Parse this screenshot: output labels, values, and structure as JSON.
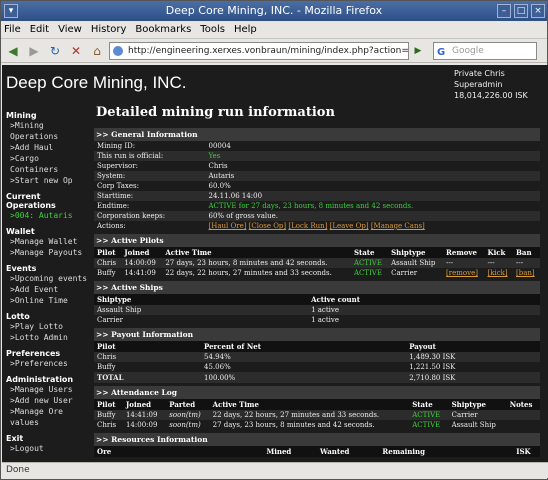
{
  "window": {
    "title": "Deep Core Mining, INC. - Mozilla Firefox"
  },
  "menu": [
    "File",
    "Edit",
    "View",
    "History",
    "Bookmarks",
    "Tools",
    "Help"
  ],
  "nav": {
    "url": "http://engineering.xerxes.vonbraun/mining/index.php?action=show&id=4",
    "search_placeholder": "Google"
  },
  "header": {
    "brand": "Deep Core Mining, INC.",
    "user_line1": "Private  Chris",
    "user_line2": "Superadmin",
    "user_line3": "18,014,226.00  ISK"
  },
  "sidebar": [
    {
      "section": "Mining",
      "items": [
        ">Mining Operations",
        ">Add Haul",
        ">Cargo Containers",
        ">Start new Op"
      ]
    },
    {
      "section": "Current Operations",
      "items": [
        ">004: Autaris"
      ],
      "active": 0
    },
    {
      "section": "Wallet",
      "items": [
        ">Manage Wallet",
        ">Manage Payouts"
      ]
    },
    {
      "section": "Events",
      "items": [
        ">Upcoming events",
        ">Add Event",
        ">Online Time"
      ]
    },
    {
      "section": "Lotto",
      "items": [
        ">Play Lotto",
        ">Lotto Admin"
      ]
    },
    {
      "section": "Preferences",
      "items": [
        ">Preferences"
      ]
    },
    {
      "section": "Administration",
      "items": [
        ">Manage Users",
        ">Add new User",
        ">Manage Ore values"
      ]
    },
    {
      "section": "Exit",
      "items": [
        ">Logout"
      ]
    }
  ],
  "main": {
    "title": "Detailed mining run information",
    "general": {
      "heading": ">> General Information",
      "rows": [
        [
          "Mining ID:",
          "00004"
        ],
        [
          "This run is official:",
          "Yes"
        ],
        [
          "Supervisor:",
          "Chris"
        ],
        [
          "System:",
          "Autaris"
        ],
        [
          "Corp Taxes:",
          "60.0%"
        ],
        [
          "Starttime:",
          "24.11.06 14:00"
        ],
        [
          "Endtime:",
          "ACTIVE for 27 days, 23 hours, 8 minutes and 42 seconds."
        ],
        [
          "Corporation keeps:",
          "60% of gross value."
        ]
      ],
      "actions_label": "Actions:",
      "actions": [
        "[Haul Ore]",
        "[Close Op]",
        "[Lock Run]",
        "[Leave Op]",
        "[Manage Cans]"
      ]
    },
    "pilots": {
      "heading": ">> Active Pilots",
      "columns": [
        "Pilot",
        "Joined",
        "Active Time",
        "State",
        "Shiptype",
        "Remove",
        "Kick",
        "Ban"
      ],
      "rows": [
        [
          "Chris",
          "14:00:09",
          "27 days, 23 hours, 8 minutes and 42 seconds.",
          "ACTIVE",
          "Assault Ship",
          "---",
          "---",
          "---"
        ],
        [
          "Buffy",
          "14:41:09",
          "22 days, 22 hours, 27 minutes and 33 seconds.",
          "ACTIVE",
          "Carrier",
          "[remove]",
          "[kick]",
          "[ban]"
        ]
      ]
    },
    "ships": {
      "heading": ">> Active Ships",
      "columns": [
        "Shiptype",
        "Active count"
      ],
      "rows": [
        [
          "Assault Ship",
          "1 active"
        ],
        [
          "Carrier",
          "1 active"
        ]
      ]
    },
    "payout": {
      "heading": ">> Payout Information",
      "columns": [
        "Pilot",
        "Percent of Net",
        "Payout"
      ],
      "rows": [
        [
          "Chris",
          "54.94%",
          "1,489.30 ISK"
        ],
        [
          "Buffy",
          "45.06%",
          "1,221.50 ISK"
        ],
        [
          "TOTAL",
          "100.00%",
          "2,710.80 ISK"
        ]
      ]
    },
    "attendance": {
      "heading": ">> Attendance Log",
      "columns": [
        "Pilot",
        "Joined",
        "Parted",
        "Active Time",
        "State",
        "Shiptype",
        "Notes"
      ],
      "rows": [
        [
          "Buffy",
          "14:41:09",
          "soon(tm)",
          "22 days, 22 hours, 27 minutes and 33 seconds.",
          "ACTIVE",
          "Carrier",
          ""
        ],
        [
          "Chris",
          "14:00:09",
          "soon(tm)",
          "27 days, 23 hours, 8 minutes and 42 seconds.",
          "ACTIVE",
          "Assault Ship",
          ""
        ]
      ]
    },
    "resources": {
      "heading": ">> Resources Information",
      "columns": [
        "Ore",
        "Mined",
        "Wanted",
        "Remaining",
        "ISK"
      ]
    }
  },
  "status": "Done"
}
